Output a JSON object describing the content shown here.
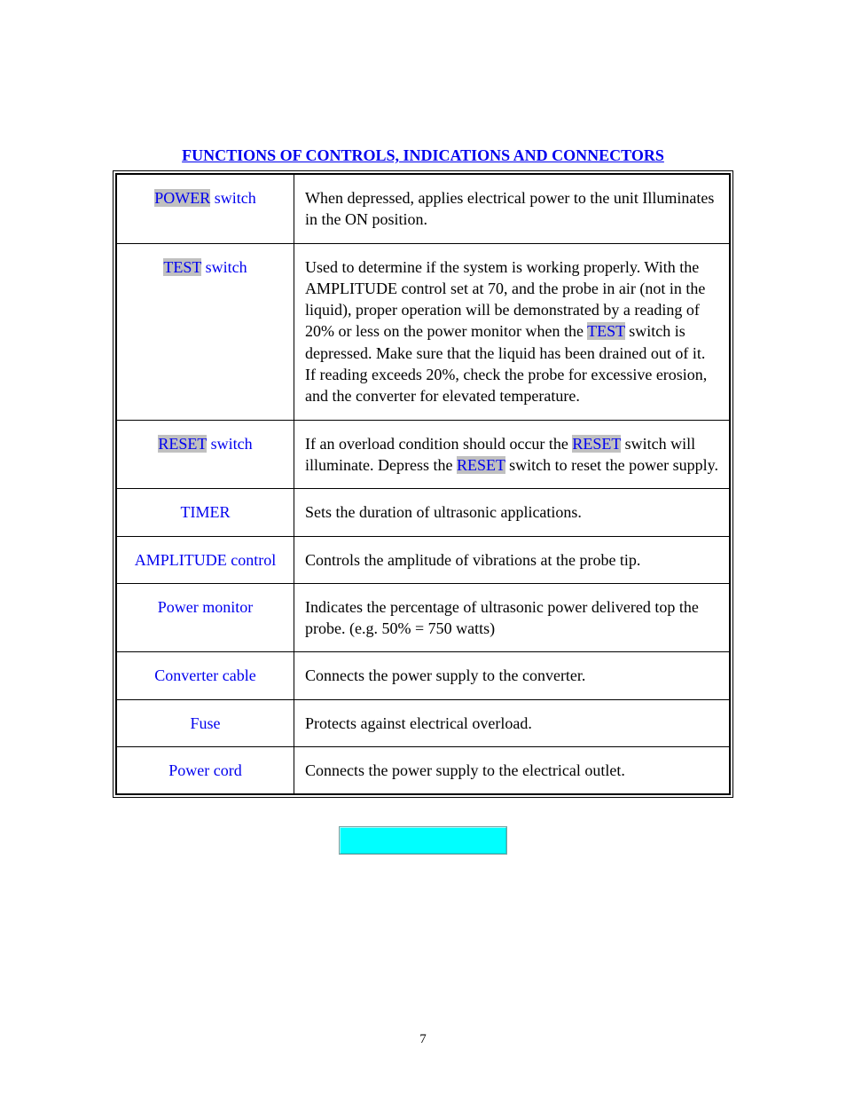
{
  "heading": "FUNCTIONS OF CONTROLS, INDICATIONS AND CONNECTORS",
  "rows": [
    {
      "label_hl": "POWER",
      "label_rest": " switch",
      "desc_pre": "When depressed, applies electrical power to the unit Illuminates in the ON position.",
      "desc_mid_hl": "",
      "desc_post": ""
    },
    {
      "label_hl": "TEST",
      "label_rest": " switch",
      "desc_pre": "Used to determine if the system is working properly. With the AMPLITUDE control set at 70, and the probe in air (not in the liquid), proper operation will be demonstrated by a reading of 20% or less on the power monitor when the ",
      "desc_mid_hl": "TEST",
      "desc_post": " switch is depressed. Make sure that the liquid has been drained out of it. If reading exceeds 20%, check the probe for excessive erosion, and the converter for elevated temperature."
    },
    {
      "label_hl": "RESET",
      "label_rest": " switch",
      "desc_special": true,
      "p1": "If an overload condition should occur the ",
      "p1_hl": "RESET",
      "p2": " switch will illuminate. Depress the ",
      "p2_hl": "RESET",
      "p3": " switch to reset the power supply."
    },
    {
      "label_plain": "TIMER",
      "desc_pre": "Sets the duration of ultrasonic applications.",
      "desc_mid_hl": "",
      "desc_post": ""
    },
    {
      "label_plain": "AMPLITUDE control",
      "desc_pre": "Controls the amplitude of vibrations at the probe tip.",
      "desc_mid_hl": "",
      "desc_post": ""
    },
    {
      "label_plain": "Power monitor",
      "desc_pre": "Indicates the percentage of ultrasonic power delivered top the probe. (e.g. 50% = 750 watts)",
      "desc_mid_hl": "",
      "desc_post": ""
    },
    {
      "label_plain": "Converter cable",
      "desc_pre": "Connects the power supply to the converter.",
      "desc_mid_hl": "",
      "desc_post": ""
    },
    {
      "label_plain": "Fuse",
      "desc_pre": "Protects against electrical overload.",
      "desc_mid_hl": "",
      "desc_post": ""
    },
    {
      "label_plain": "Power cord",
      "desc_pre": "Connects the power supply to the electrical outlet.",
      "desc_mid_hl": "",
      "desc_post": ""
    }
  ],
  "page_number": "7"
}
